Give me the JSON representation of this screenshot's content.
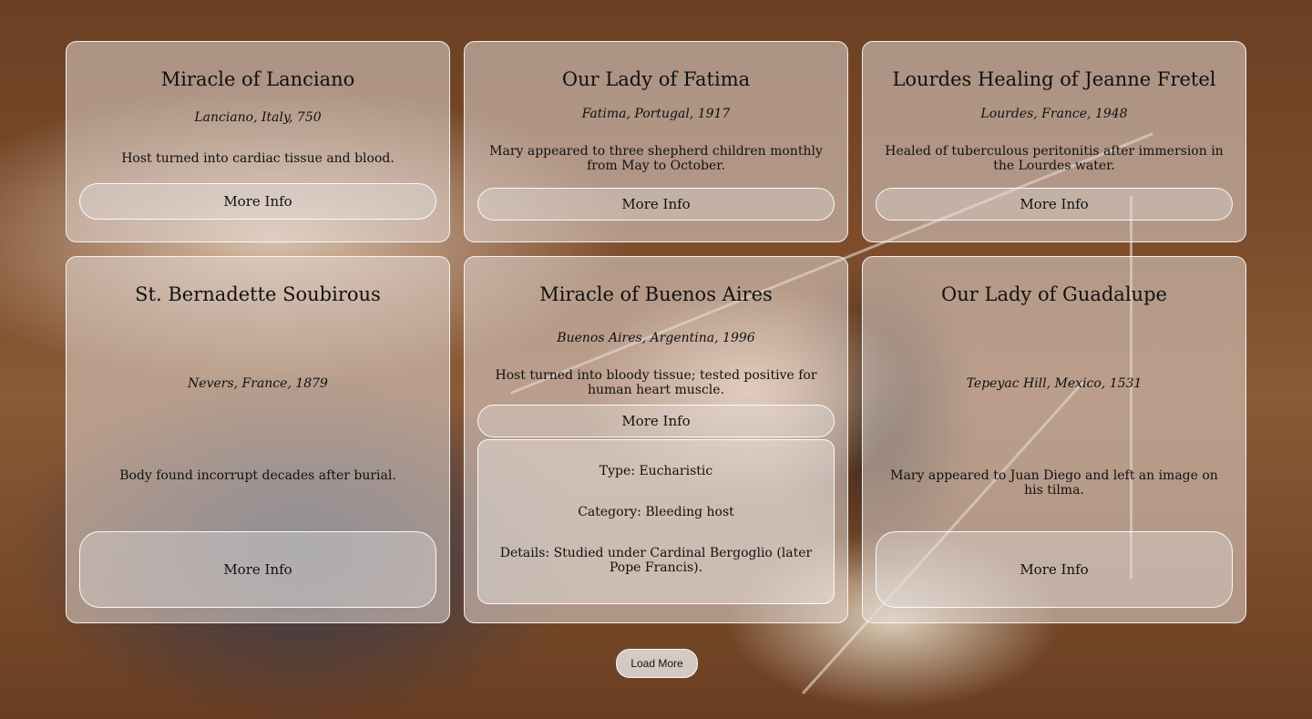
{
  "cards": [
    {
      "title": "Miracle of Lanciano",
      "location": "Lanciano, Italy, 750",
      "description": "Host turned into cardiac tissue and blood.",
      "button": "More Info"
    },
    {
      "title": "Our Lady of Fatima",
      "location": "Fatima, Portugal, 1917",
      "description": "Mary appeared to three shepherd children monthly from May to October.",
      "button": "More Info"
    },
    {
      "title": "Lourdes Healing of Jeanne Fretel",
      "location": "Lourdes, France, 1948",
      "description": "Healed of tuberculous peritonitis after immersion in the Lourdes water.",
      "button": "More Info"
    },
    {
      "title": "St. Bernadette Soubirous",
      "location": "Nevers, France, 1879",
      "description": "Body found incorrupt decades after burial.",
      "button": "More Info"
    },
    {
      "title": "Miracle of Buenos Aires",
      "location": "Buenos Aires, Argentina, 1996",
      "description": "Host turned into bloody tissue; tested positive for human heart muscle.",
      "button": "More Info",
      "details": {
        "type": "Type: Eucharistic",
        "category": "Category: Bleeding host",
        "details": "Details: Studied under Cardinal Bergoglio (later Pope Francis)."
      }
    },
    {
      "title": "Our Lady of Guadalupe",
      "location": "Tepeyac Hill, Mexico, 1531",
      "description": "Mary appeared to Juan Diego and left an image on his tilma.",
      "button": "More Info"
    }
  ],
  "load_more_label": "Load More"
}
